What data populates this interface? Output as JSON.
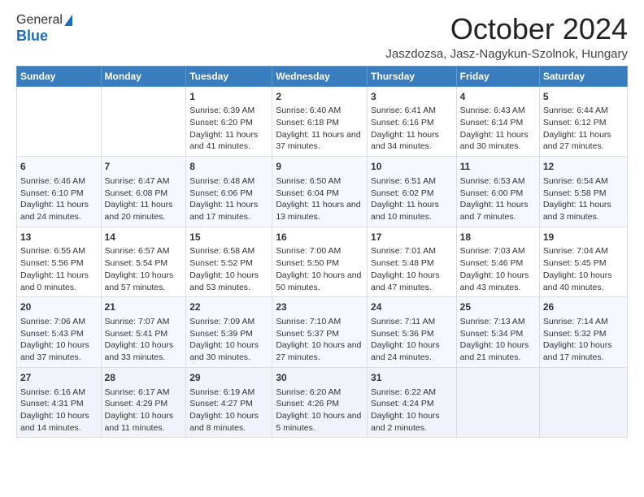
{
  "header": {
    "logo_general": "General",
    "logo_blue": "Blue",
    "month_title": "October 2024",
    "location": "Jaszdozsa, Jasz-Nagykun-Szolnok, Hungary"
  },
  "days_of_week": [
    "Sunday",
    "Monday",
    "Tuesday",
    "Wednesday",
    "Thursday",
    "Friday",
    "Saturday"
  ],
  "weeks": [
    [
      {
        "day": "",
        "content": ""
      },
      {
        "day": "",
        "content": ""
      },
      {
        "day": "1",
        "content": "Sunrise: 6:39 AM\nSunset: 6:20 PM\nDaylight: 11 hours and 41 minutes."
      },
      {
        "day": "2",
        "content": "Sunrise: 6:40 AM\nSunset: 6:18 PM\nDaylight: 11 hours and 37 minutes."
      },
      {
        "day": "3",
        "content": "Sunrise: 6:41 AM\nSunset: 6:16 PM\nDaylight: 11 hours and 34 minutes."
      },
      {
        "day": "4",
        "content": "Sunrise: 6:43 AM\nSunset: 6:14 PM\nDaylight: 11 hours and 30 minutes."
      },
      {
        "day": "5",
        "content": "Sunrise: 6:44 AM\nSunset: 6:12 PM\nDaylight: 11 hours and 27 minutes."
      }
    ],
    [
      {
        "day": "6",
        "content": "Sunrise: 6:46 AM\nSunset: 6:10 PM\nDaylight: 11 hours and 24 minutes."
      },
      {
        "day": "7",
        "content": "Sunrise: 6:47 AM\nSunset: 6:08 PM\nDaylight: 11 hours and 20 minutes."
      },
      {
        "day": "8",
        "content": "Sunrise: 6:48 AM\nSunset: 6:06 PM\nDaylight: 11 hours and 17 minutes."
      },
      {
        "day": "9",
        "content": "Sunrise: 6:50 AM\nSunset: 6:04 PM\nDaylight: 11 hours and 13 minutes."
      },
      {
        "day": "10",
        "content": "Sunrise: 6:51 AM\nSunset: 6:02 PM\nDaylight: 11 hours and 10 minutes."
      },
      {
        "day": "11",
        "content": "Sunrise: 6:53 AM\nSunset: 6:00 PM\nDaylight: 11 hours and 7 minutes."
      },
      {
        "day": "12",
        "content": "Sunrise: 6:54 AM\nSunset: 5:58 PM\nDaylight: 11 hours and 3 minutes."
      }
    ],
    [
      {
        "day": "13",
        "content": "Sunrise: 6:55 AM\nSunset: 5:56 PM\nDaylight: 11 hours and 0 minutes."
      },
      {
        "day": "14",
        "content": "Sunrise: 6:57 AM\nSunset: 5:54 PM\nDaylight: 10 hours and 57 minutes."
      },
      {
        "day": "15",
        "content": "Sunrise: 6:58 AM\nSunset: 5:52 PM\nDaylight: 10 hours and 53 minutes."
      },
      {
        "day": "16",
        "content": "Sunrise: 7:00 AM\nSunset: 5:50 PM\nDaylight: 10 hours and 50 minutes."
      },
      {
        "day": "17",
        "content": "Sunrise: 7:01 AM\nSunset: 5:48 PM\nDaylight: 10 hours and 47 minutes."
      },
      {
        "day": "18",
        "content": "Sunrise: 7:03 AM\nSunset: 5:46 PM\nDaylight: 10 hours and 43 minutes."
      },
      {
        "day": "19",
        "content": "Sunrise: 7:04 AM\nSunset: 5:45 PM\nDaylight: 10 hours and 40 minutes."
      }
    ],
    [
      {
        "day": "20",
        "content": "Sunrise: 7:06 AM\nSunset: 5:43 PM\nDaylight: 10 hours and 37 minutes."
      },
      {
        "day": "21",
        "content": "Sunrise: 7:07 AM\nSunset: 5:41 PM\nDaylight: 10 hours and 33 minutes."
      },
      {
        "day": "22",
        "content": "Sunrise: 7:09 AM\nSunset: 5:39 PM\nDaylight: 10 hours and 30 minutes."
      },
      {
        "day": "23",
        "content": "Sunrise: 7:10 AM\nSunset: 5:37 PM\nDaylight: 10 hours and 27 minutes."
      },
      {
        "day": "24",
        "content": "Sunrise: 7:11 AM\nSunset: 5:36 PM\nDaylight: 10 hours and 24 minutes."
      },
      {
        "day": "25",
        "content": "Sunrise: 7:13 AM\nSunset: 5:34 PM\nDaylight: 10 hours and 21 minutes."
      },
      {
        "day": "26",
        "content": "Sunrise: 7:14 AM\nSunset: 5:32 PM\nDaylight: 10 hours and 17 minutes."
      }
    ],
    [
      {
        "day": "27",
        "content": "Sunrise: 6:16 AM\nSunset: 4:31 PM\nDaylight: 10 hours and 14 minutes."
      },
      {
        "day": "28",
        "content": "Sunrise: 6:17 AM\nSunset: 4:29 PM\nDaylight: 10 hours and 11 minutes."
      },
      {
        "day": "29",
        "content": "Sunrise: 6:19 AM\nSunset: 4:27 PM\nDaylight: 10 hours and 8 minutes."
      },
      {
        "day": "30",
        "content": "Sunrise: 6:20 AM\nSunset: 4:26 PM\nDaylight: 10 hours and 5 minutes."
      },
      {
        "day": "31",
        "content": "Sunrise: 6:22 AM\nSunset: 4:24 PM\nDaylight: 10 hours and 2 minutes."
      },
      {
        "day": "",
        "content": ""
      },
      {
        "day": "",
        "content": ""
      }
    ]
  ]
}
